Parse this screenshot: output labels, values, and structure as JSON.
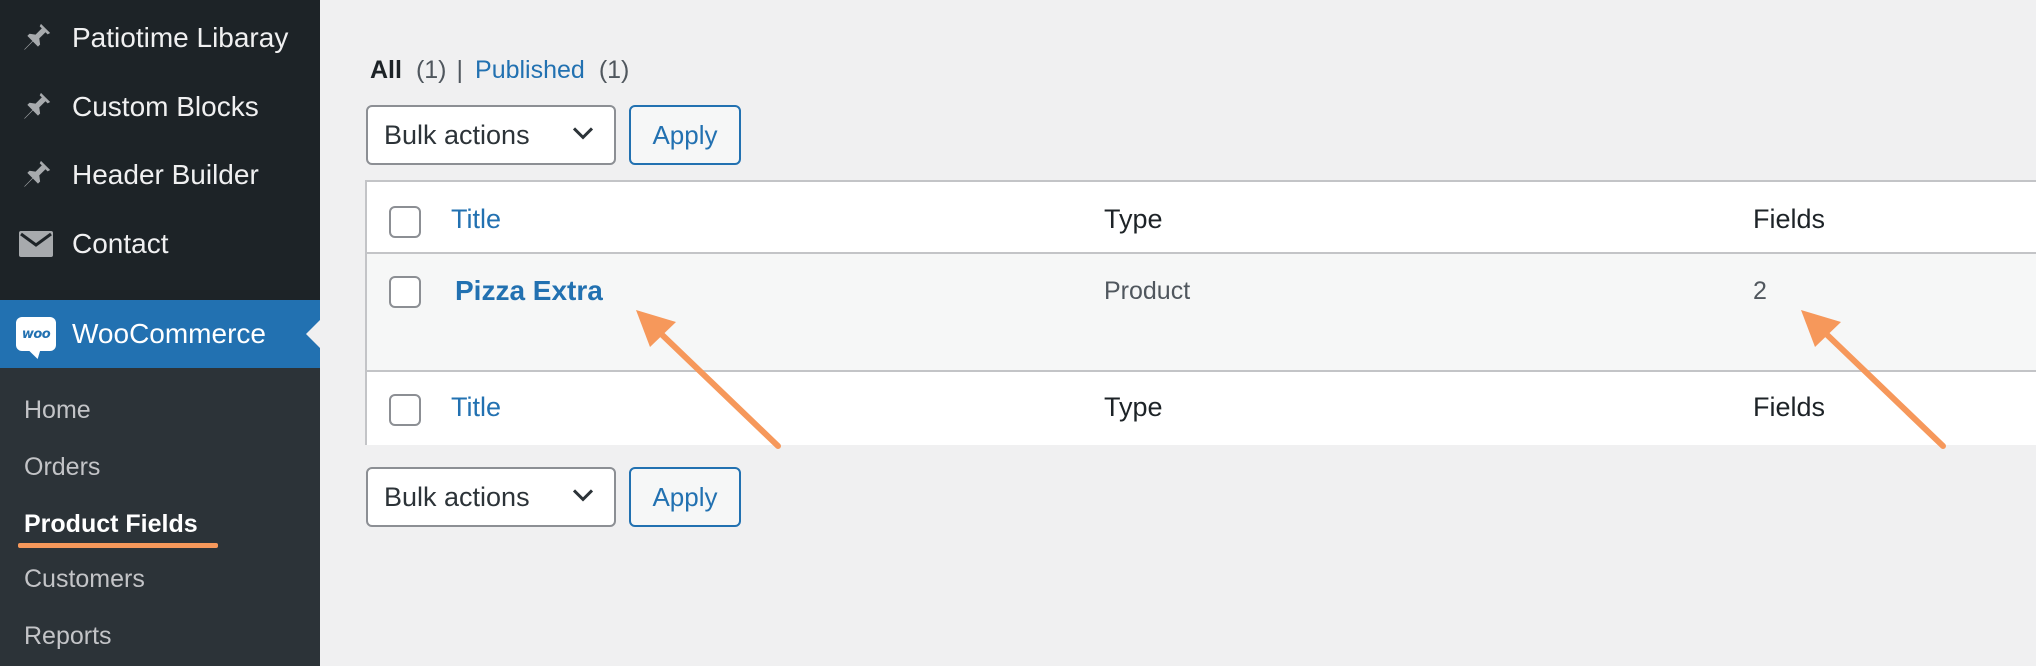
{
  "sidebar": {
    "items": [
      {
        "label": "Patiotime Libaray",
        "icon": "pin-icon"
      },
      {
        "label": "Custom Blocks",
        "icon": "pin-icon"
      },
      {
        "label": "Header Builder",
        "icon": "pin-icon"
      },
      {
        "label": "Contact",
        "icon": "envelope-icon"
      },
      {
        "label": "WooCommerce",
        "icon": "woocommerce-icon",
        "logo_text": "woo"
      }
    ],
    "submenu": [
      "Home",
      "Orders",
      "Product Fields",
      "Customers",
      "Reports"
    ]
  },
  "filters": {
    "all_label": "All",
    "all_count": "(1)",
    "separator": "|",
    "published_label": "Published",
    "published_count": "(1)"
  },
  "bulk_actions": {
    "label": "Bulk actions",
    "apply": "Apply"
  },
  "table": {
    "columns": [
      "Title",
      "Type",
      "Fields"
    ],
    "rows": [
      {
        "title": "Pizza Extra",
        "type": "Product",
        "fields": "2"
      }
    ]
  },
  "colors": {
    "sidebar_bg": "#1d2327",
    "submenu_bg": "#2c3338",
    "accent": "#2271b1",
    "annotation": "#f6985b"
  }
}
